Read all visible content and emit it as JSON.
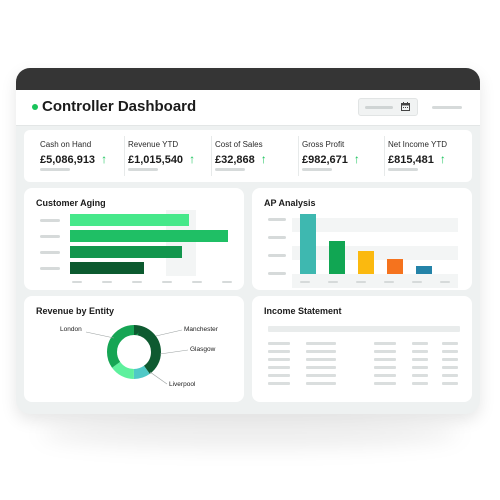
{
  "header": {
    "title": "Controller Dashboard",
    "calendar_icon": "calendar-icon"
  },
  "kpis": [
    {
      "label": "Cash on Hand",
      "value": "£5,086,913",
      "trend": "up"
    },
    {
      "label": "Revenue YTD",
      "value": "£1,015,540",
      "trend": "up"
    },
    {
      "label": "Cost of Sales",
      "value": "£32,868",
      "trend": "up"
    },
    {
      "label": "Gross Profit",
      "value": "£982,671",
      "trend": "up"
    },
    {
      "label": "Net Income YTD",
      "value": "£815,481",
      "trend": "up"
    }
  ],
  "arrow_glyph": "↑",
  "customer_aging": {
    "title": "Customer Aging",
    "values": [
      0.66,
      0.88,
      0.62,
      0.41
    ],
    "colors": [
      "#46e88a",
      "#1fbf65",
      "#12964d",
      "#0c5a2f"
    ]
  },
  "ap_analysis": {
    "title": "AP Analysis",
    "values": [
      1.0,
      0.55,
      0.38,
      0.25,
      0.13
    ],
    "colors": [
      "#3eb8b0",
      "#11a653",
      "#fbb90f",
      "#f5731e",
      "#2483a8"
    ]
  },
  "revenue_by_entity": {
    "title": "Revenue by Entity",
    "entities": [
      "London",
      "Manchester",
      "Glasgow",
      "Liverpool"
    ],
    "shares": [
      0.4,
      0.1,
      0.15,
      0.35
    ],
    "colors": [
      "#0e5a30",
      "#4fc9c6",
      "#5ef09d",
      "#16a554"
    ]
  },
  "income_statement": {
    "title": "Income Statement"
  },
  "colors": {
    "accent": "#18c35a",
    "titlebar": "#353535",
    "background": "#eef1f1"
  }
}
